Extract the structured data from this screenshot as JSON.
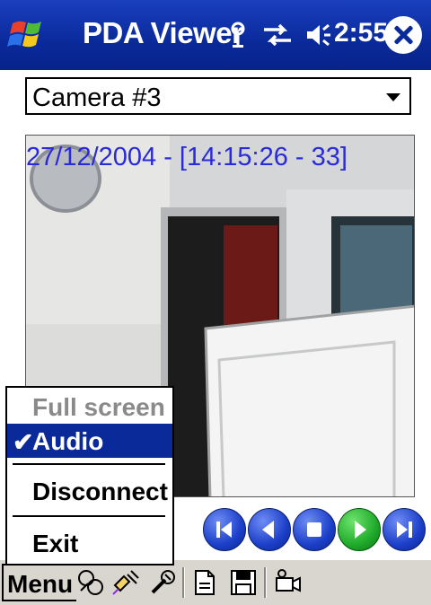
{
  "titlebar": {
    "title": "PDA Viewer",
    "time": "2:55",
    "icons": [
      "start-logo-icon",
      "connectivity-icon",
      "sync-icon",
      "speaker-icon",
      "close-icon"
    ]
  },
  "camera_select": {
    "value": "Camera #3"
  },
  "video": {
    "timestamp": "27/12/2004 - [14:15:26 - 33]"
  },
  "controls": [
    "skip-back-icon",
    "rewind-icon",
    "stop-icon",
    "play-icon",
    "skip-forward-icon"
  ],
  "menu": {
    "items": [
      {
        "label": "Full screen",
        "state": "disabled"
      },
      {
        "label": "Audio",
        "state": "checked"
      },
      {
        "label": "Disconnect",
        "state": "normal"
      },
      {
        "label": "Exit",
        "state": "normal"
      }
    ]
  },
  "cmdbar": {
    "menu_label": "Menu",
    "tools": [
      "network-icon",
      "connect-icon",
      "settings-icon",
      "snapshot-icon",
      "save-icon",
      "camera-record-icon"
    ]
  },
  "colors": {
    "titlebar": "#0a2a9a",
    "timestamp": "#2a2ad8",
    "selected": "#0a2a9a",
    "play": "#1faa2a"
  }
}
